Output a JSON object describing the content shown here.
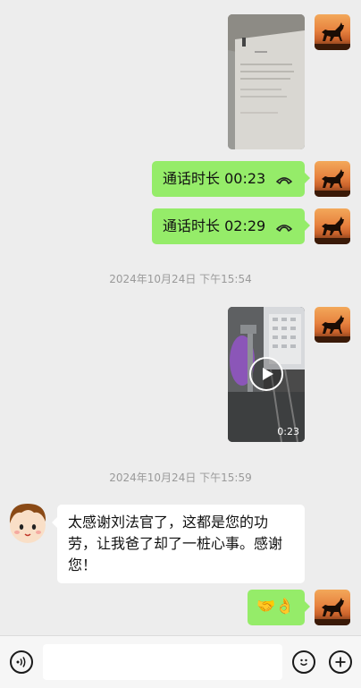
{
  "messages": {
    "call1": "通话时长 00:23",
    "call2": "通话时长 02:29",
    "time1": "2024年10月24日 下午15:54",
    "video_duration": "0:23",
    "time2": "2024年10月24日 下午15:59",
    "thanks_text": "太感谢刘法官了，这都是您的功劳，让我爸了却了一桩心事。感谢您！",
    "emoji_reply": "🤝👌"
  },
  "icons": {
    "avatar_self": "horse-avatar-icon",
    "avatar_other": "cartoon-boy-avatar-icon",
    "voice": "voice-icon",
    "emoji": "emoji-icon",
    "plus": "plus-icon",
    "phone": "phone-hangup-icon",
    "play": "play-icon"
  },
  "colors": {
    "chat_bg": "#ededed",
    "sent_bubble": "#95ec69",
    "received_bubble": "#ffffff"
  }
}
